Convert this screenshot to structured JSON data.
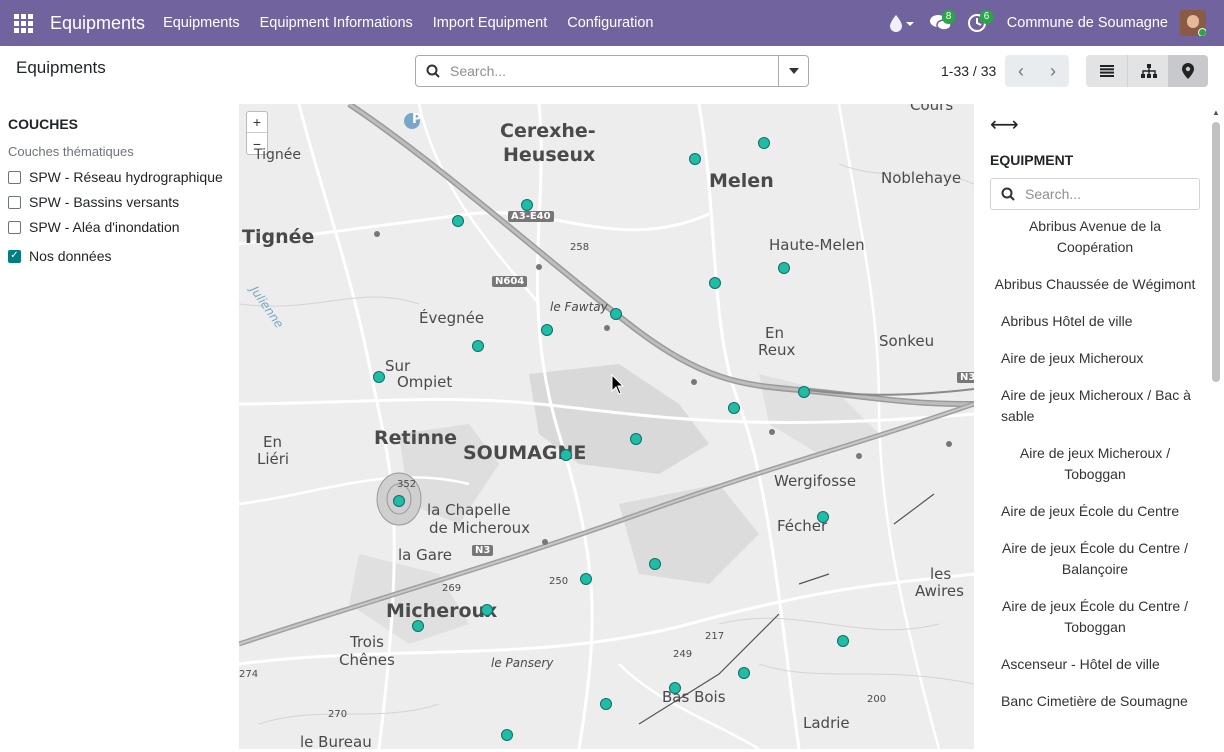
{
  "navbar": {
    "brand": "Equipments",
    "menu": [
      "Equipments",
      "Equipment Informations",
      "Import Equipment",
      "Configuration"
    ],
    "messages_count": "8",
    "activities_count": "6",
    "company": "Commune de Soumagne"
  },
  "control": {
    "title": "Equipments",
    "search_placeholder": "Search...",
    "pager": "1-33 / 33"
  },
  "layers": {
    "title": "COUCHES",
    "subtitle": "Couches thématiques",
    "items": [
      {
        "label": "SPW - Réseau hydrographique",
        "checked": false
      },
      {
        "label": "SPW - Bassins versants",
        "checked": false
      },
      {
        "label": "SPW - Aléa d'inondation",
        "checked": false
      },
      {
        "label": "Nos données",
        "checked": true
      }
    ]
  },
  "map": {
    "zoom_in": "+",
    "zoom_out": "−",
    "labels": {
      "cerexhe": "Cerexhe-",
      "heuseux": "Heuseux",
      "melen": "Melen",
      "noblehaye": "Noblehaye",
      "tignee_small": "Tignée",
      "tignee": "Tignée",
      "haute_melen": "Haute-Melen",
      "a3": "A3-E40",
      "n604": "N604",
      "fawtay": "le Fawtay",
      "evegnee": "Évegnée",
      "en_reux_1": "En",
      "en_reux_2": "Reux",
      "sonkeu": "Sonkeu",
      "sur": "Sur",
      "ompiet": "Ompiet",
      "retinne": "Retinne",
      "soumagne": "SOUMAGNE",
      "en_lieri_1": "En",
      "en_lieri_2": "Liéri",
      "wergifosse": "Wergifosse",
      "chapelle_1": "la Chapelle",
      "chapelle_2": "de Micheroux",
      "fecher": "Fécher",
      "la_gare": "la Gare",
      "n3": "N3",
      "les_1": "les",
      "les_2": "Awires",
      "micheroux": "Micheroux",
      "trois_1": "Trois",
      "trois_2": "Chênes",
      "pansery": "le Pansery",
      "bas_bois": "Bas Bois",
      "ladrie": "Ladrie",
      "bureau": "le Bureau",
      "cours": "Cours",
      "n3_right": "N3",
      "julienne": "Julienne",
      "e258": "258",
      "e352": "352",
      "e269": "269",
      "e250": "250",
      "e249": "249",
      "e217": "217",
      "e274": "274",
      "e270": "270",
      "e200": "200",
      "p": "P"
    },
    "marker_count": 25
  },
  "equip_panel": {
    "title": "EQUIPMENT",
    "search_placeholder": "Search...",
    "items": [
      {
        "label": "Abribus Avenue de la Coopération",
        "align": "center"
      },
      {
        "label": "Abribus Chaussée de Wégimont",
        "align": "center"
      },
      {
        "label": "Abribus Hôtel de ville",
        "align": "left"
      },
      {
        "label": "Aire de jeux Micheroux",
        "align": "left"
      },
      {
        "label": "Aire de jeux Micheroux / Bac à sable",
        "align": "left"
      },
      {
        "label": "Aire de jeux Micheroux / Toboggan",
        "align": "center"
      },
      {
        "label": "Aire de jeux École du Centre",
        "align": "left"
      },
      {
        "label": "Aire de jeux École du Centre / Balançoire",
        "align": "center"
      },
      {
        "label": "Aire de jeux École du Centre / Toboggan",
        "align": "center"
      },
      {
        "label": "Ascenseur - Hôtel de ville",
        "align": "left"
      },
      {
        "label": "Banc Cimetière de Soumagne",
        "align": "left"
      }
    ]
  }
}
